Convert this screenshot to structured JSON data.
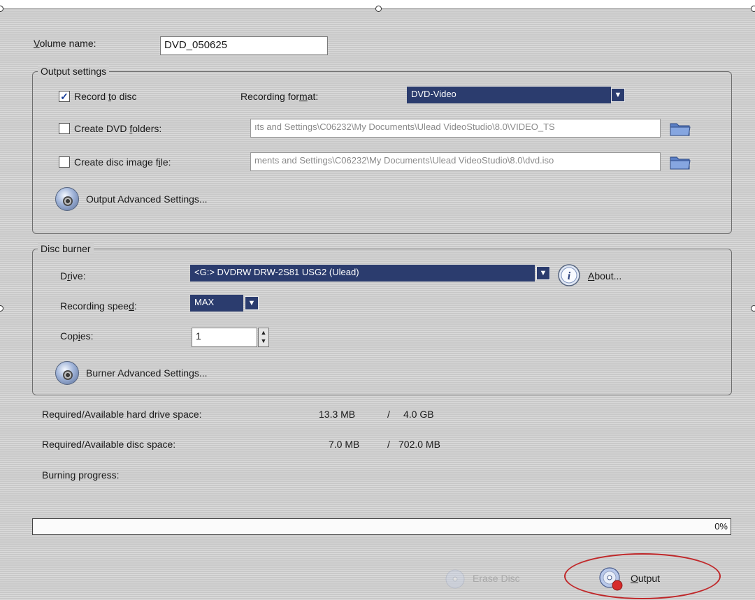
{
  "volume": {
    "label": "Volume name:",
    "value": "DVD_050625"
  },
  "output_settings": {
    "legend": "Output settings",
    "record_to_disc": {
      "label": "Record to disc",
      "checked": true
    },
    "recording_format": {
      "label": "Recording format:",
      "value": "DVD-Video"
    },
    "create_dvd_folders": {
      "label": "Create DVD folders:",
      "checked": false,
      "path": "ıts and Settings\\C06232\\My Documents\\Ulead VideoStudio\\8.0\\VIDEO_TS"
    },
    "create_disc_image": {
      "label": "Create disc image file:",
      "checked": false,
      "path": "ments and Settings\\C06232\\My Documents\\Ulead VideoStudio\\8.0\\dvd.iso"
    },
    "advanced_button": "Output Advanced Settings..."
  },
  "disc_burner": {
    "legend": "Disc burner",
    "drive": {
      "label": "Drive:",
      "value": "<G:>  DVDRW DRW-2S81  USG2 (Ulead)"
    },
    "about": "About...",
    "speed": {
      "label": "Recording speed:",
      "value": "MAX"
    },
    "copies": {
      "label": "Copies:",
      "value": "1"
    },
    "advanced_button": "Burner Advanced Settings..."
  },
  "space": {
    "hdd_label": "Required/Available hard drive space:",
    "hdd_required": "13.3 MB",
    "hdd_available": "4.0 GB",
    "disc_label": "Required/Available disc space:",
    "disc_required": "7.0 MB",
    "disc_available": "702.0 MB",
    "separator": "/"
  },
  "progress": {
    "label": "Burning progress:",
    "percent_text": "0%",
    "value": 0
  },
  "buttons": {
    "erase": "Erase Disc",
    "output": "Output"
  },
  "colors": {
    "select_bg": "#2b3c6e",
    "annotation": "#c0282a",
    "panel": "#cfcfcf"
  },
  "icons": {
    "folder": "folder-icon",
    "gear": "gear-icon",
    "info": "info-icon",
    "disc": "disc-icon"
  }
}
